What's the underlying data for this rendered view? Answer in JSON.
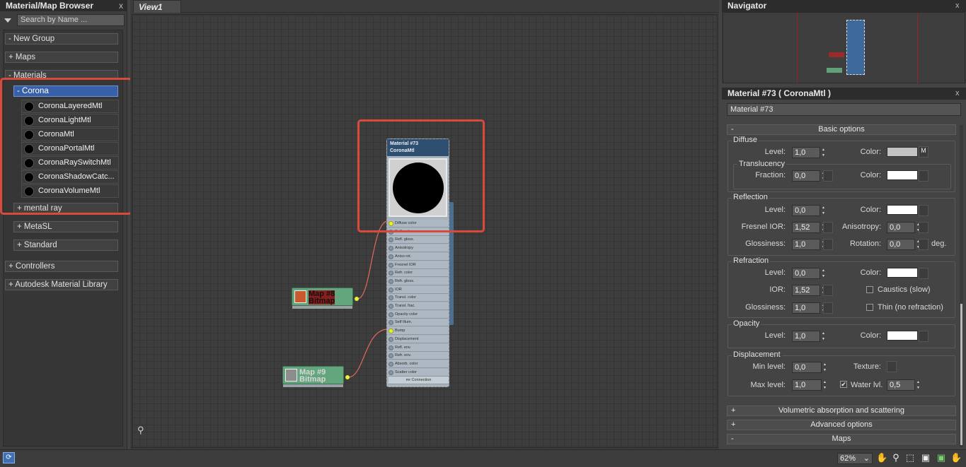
{
  "browser": {
    "title": "Material/Map Browser",
    "close": "x",
    "search_placeholder": "Search by Name ...",
    "groups": {
      "new_group": "- New Group",
      "maps": "+ Maps",
      "materials": "- Materials",
      "corona": "- Corona",
      "mental_ray": "+ mental ray",
      "metasl": "+ MetaSL",
      "standard": "+ Standard",
      "controllers": "+ Controllers",
      "autodesk": "+ Autodesk Material Library"
    },
    "corona_items": [
      "CoronaLayeredMtl",
      "CoronaLightMtl",
      "CoronaMtl",
      "CoronaPortalMtl",
      "CoronaRaySwitchMtl",
      "CoronaShadowCatc...",
      "CoronaVolumeMtl"
    ]
  },
  "view": {
    "tab": "View1",
    "node": {
      "title": "Material #73",
      "type": "CoronaMtl",
      "slots": [
        "Diffuse color",
        "Refl. color",
        "Refl. gloss.",
        "Anisotropy",
        "Aniso rot.",
        "Fresnel IOR",
        "Refr. color",
        "Refr. gloss.",
        "IOR",
        "Transl. color",
        "Transl. frac.",
        "Opacity color",
        "Self Illum.",
        "Bump",
        "Displacement",
        "Refl. env.",
        "Refr. env.",
        "Absorb. color",
        "Scatter color",
        "mr Connection"
      ]
    },
    "map_node_1": {
      "title": "Map #8",
      "type": "Bitmap"
    },
    "map_node_2": {
      "title": "Map #9",
      "type": "Bitmap"
    }
  },
  "navigator": {
    "title": "Navigator",
    "close": "x"
  },
  "material": {
    "title": "Material #73  ( CoronaMtl )",
    "close": "x",
    "name": "Material #73",
    "rollouts": {
      "basic": "Basic options",
      "volumetric": "Volumetric absorption and scattering",
      "advanced": "Advanced options",
      "maps": "Maps"
    },
    "signs": {
      "minus": "-",
      "plus": "+"
    },
    "diffuse": {
      "title": "Diffuse",
      "level_label": "Level:",
      "level": "1,0",
      "color_label": "Color:",
      "color": "#c2c2c2",
      "m": "M"
    },
    "translucency": {
      "title": "Translucency",
      "fraction_label": "Fraction:",
      "fraction": "0,0",
      "color_label": "Color:",
      "color": "#ffffff"
    },
    "reflection": {
      "title": "Reflection",
      "level_label": "Level:",
      "level": "0,0",
      "color_label": "Color:",
      "color": "#ffffff",
      "ior_label": "Fresnel IOR:",
      "ior": "1,52",
      "aniso_label": "Anisotropy:",
      "aniso": "0,0",
      "gloss_label": "Glossiness:",
      "gloss": "1,0",
      "rot_label": "Rotation:",
      "rot": "0,0",
      "deg": "deg."
    },
    "refraction": {
      "title": "Refraction",
      "level_label": "Level:",
      "level": "0,0",
      "color_label": "Color:",
      "color": "#ffffff",
      "ior_label": "IOR:",
      "ior": "1,52",
      "caustics": "Caustics (slow)",
      "gloss_label": "Glossiness:",
      "gloss": "1,0",
      "thin": "Thin (no refraction)"
    },
    "opacity": {
      "title": "Opacity",
      "level_label": "Level:",
      "level": "1,0",
      "color_label": "Color:",
      "color": "#ffffff"
    },
    "displacement": {
      "title": "Displacement",
      "min_label": "Min level:",
      "min": "0,0",
      "texture_label": "Texture:",
      "max_label": "Max level:",
      "max": "1,0",
      "water_label": "Water lvl.",
      "water": "0,5",
      "check": "✔"
    }
  },
  "status": {
    "zoom": "62%"
  }
}
